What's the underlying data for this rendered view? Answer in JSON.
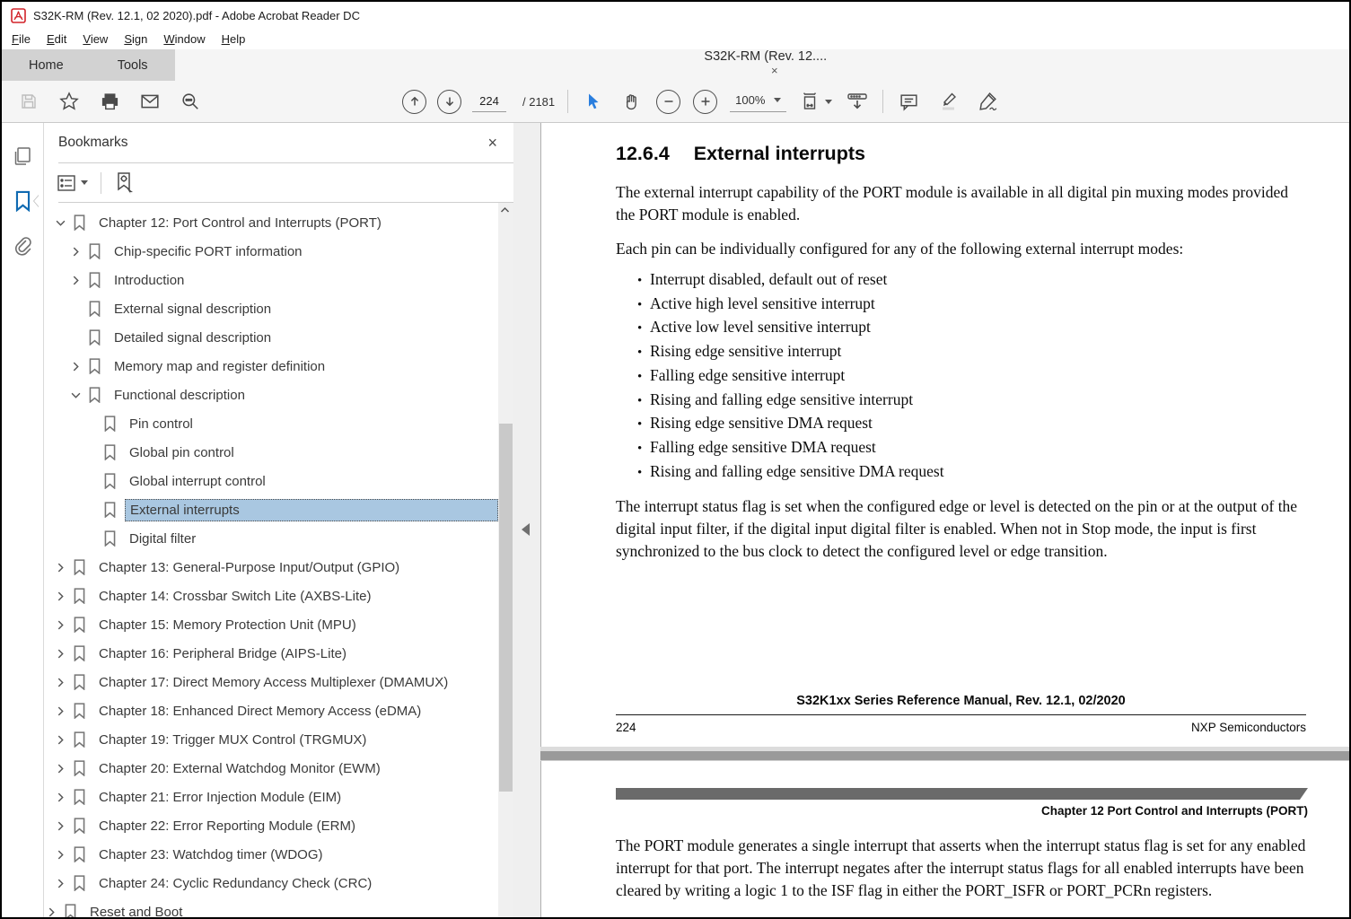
{
  "window": {
    "title": "S32K-RM (Rev. 12.1, 02 2020).pdf - Adobe Acrobat Reader DC"
  },
  "menu": {
    "items": [
      "File",
      "Edit",
      "View",
      "Sign",
      "Window",
      "Help"
    ]
  },
  "tabs": {
    "home": "Home",
    "tools": "Tools",
    "document": "S32K-RM (Rev. 12....",
    "close": "×"
  },
  "toolbar": {
    "page_current": "224",
    "page_total": "/ 2181",
    "zoom_level": "100%"
  },
  "colors": {
    "accent_blue": "#1473e6",
    "bookmark_selection": "#a9c7e1",
    "page2_bar": "#6a6a6a"
  },
  "bookmarks_panel": {
    "title": "Bookmarks",
    "close": "×",
    "items": [
      {
        "label": "Chapter 12: Port Control and Interrupts (PORT)",
        "level": 0,
        "expander": "expanded"
      },
      {
        "label": "Chip-specific PORT information",
        "level": 1,
        "expander": "collapsed"
      },
      {
        "label": "Introduction",
        "level": 1,
        "expander": "collapsed"
      },
      {
        "label": "External signal description",
        "level": 1,
        "expander": "none"
      },
      {
        "label": "Detailed signal description",
        "level": 1,
        "expander": "none"
      },
      {
        "label": "Memory map and register definition",
        "level": 1,
        "expander": "collapsed"
      },
      {
        "label": "Functional description",
        "level": 1,
        "expander": "expanded"
      },
      {
        "label": "Pin control",
        "level": 2,
        "expander": "none"
      },
      {
        "label": "Global pin control",
        "level": 2,
        "expander": "none"
      },
      {
        "label": "Global interrupt control",
        "level": 2,
        "expander": "none"
      },
      {
        "label": "External interrupts",
        "level": 2,
        "expander": "none",
        "selected": true
      },
      {
        "label": "Digital filter",
        "level": 2,
        "expander": "none"
      },
      {
        "label": "Chapter 13: General-Purpose Input/Output (GPIO)",
        "level": 0,
        "expander": "collapsed"
      },
      {
        "label": "Chapter 14: Crossbar Switch Lite (AXBS-Lite)",
        "level": 0,
        "expander": "collapsed"
      },
      {
        "label": "Chapter 15: Memory Protection Unit (MPU)",
        "level": 0,
        "expander": "collapsed"
      },
      {
        "label": "Chapter 16: Peripheral Bridge (AIPS-Lite)",
        "level": 0,
        "expander": "collapsed"
      },
      {
        "label": "Chapter 17: Direct Memory Access Multiplexer (DMAMUX)",
        "level": 0,
        "expander": "collapsed"
      },
      {
        "label": "Chapter 18: Enhanced Direct Memory Access (eDMA)",
        "level": 0,
        "expander": "collapsed"
      },
      {
        "label": "Chapter 19: Trigger MUX Control (TRGMUX)",
        "level": 0,
        "expander": "collapsed"
      },
      {
        "label": "Chapter 20: External Watchdog Monitor (EWM)",
        "level": 0,
        "expander": "collapsed"
      },
      {
        "label": "Chapter 21: Error Injection Module (EIM)",
        "level": 0,
        "expander": "collapsed"
      },
      {
        "label": "Chapter 22: Error Reporting Module (ERM)",
        "level": 0,
        "expander": "collapsed"
      },
      {
        "label": "Chapter 23: Watchdog timer (WDOG)",
        "level": 0,
        "expander": "collapsed"
      },
      {
        "label": "Chapter 24: Cyclic Redundancy Check (CRC)",
        "level": 0,
        "expander": "collapsed"
      },
      {
        "label": "Reset and Boot",
        "level": 0,
        "expander": "collapsed",
        "outdent": true,
        "cut": true
      }
    ]
  },
  "page1": {
    "heading_number": "12.6.4",
    "heading_title": "External interrupts",
    "para1": "The external interrupt capability of the PORT module is available in all digital pin muxing modes provided the PORT module is enabled.",
    "para2": "Each pin can be individually configured for any of the following external interrupt modes:",
    "bullets": [
      "Interrupt disabled, default out of reset",
      "Active high level sensitive interrupt",
      "Active low level sensitive interrupt",
      "Rising edge sensitive interrupt",
      "Falling edge sensitive interrupt",
      "Rising and falling edge sensitive interrupt",
      "Rising edge sensitive DMA request",
      "Falling edge sensitive DMA request",
      "Rising and falling edge sensitive DMA request"
    ],
    "para3": "The interrupt status flag is set when the configured edge or level is detected on the pin or at the output of the digital input filter, if the digital input digital filter is enabled. When not in Stop mode, the input is first synchronized to the bus clock to detect the configured level or edge transition.",
    "footer_center": "S32K1xx Series Reference Manual, Rev. 12.1, 02/2020",
    "footer_left": "224",
    "footer_right": "NXP Semiconductors"
  },
  "page2": {
    "header_right": "Chapter 12 Port Control and Interrupts (PORT)",
    "para1": "The PORT module generates a single interrupt that asserts when the interrupt status flag is set for any enabled interrupt for that port. The interrupt negates after the interrupt status flags for all enabled interrupts have been cleared by writing a logic 1 to the ISF flag in either the PORT_ISFR or PORT_PCRn registers."
  }
}
